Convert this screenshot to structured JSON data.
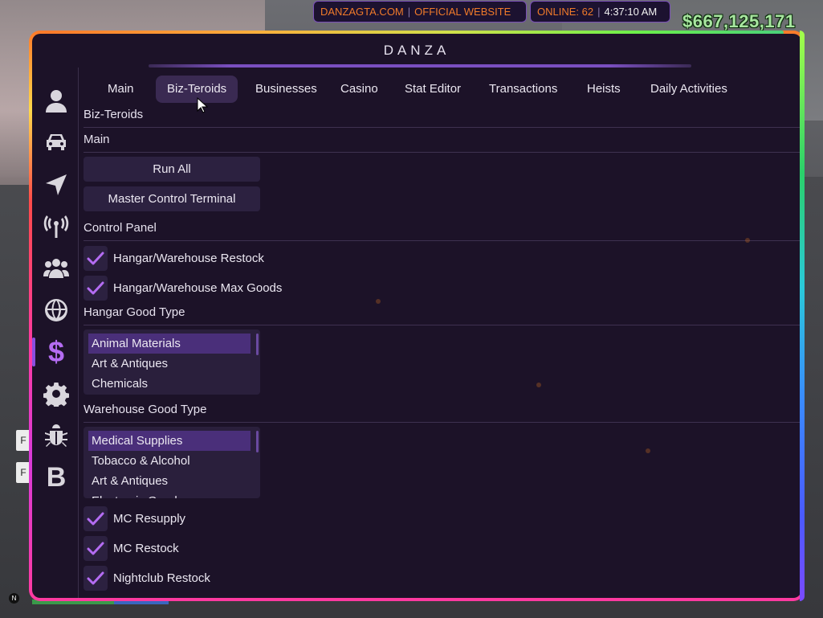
{
  "hud": {
    "site_label": "DANZAGTA.COM",
    "official_label": "OFFICIAL WEBSITE",
    "online_label": "ONLINE: 62",
    "time": "4:37:10 AM",
    "money": "$667,125,171",
    "side_hud_glyphs": [
      "F",
      "F"
    ],
    "north_label": "N"
  },
  "window": {
    "title": "DANZA"
  },
  "sidebar": {
    "items": [
      {
        "icon": "person-icon"
      },
      {
        "icon": "car-icon"
      },
      {
        "icon": "navigation-arrow-icon"
      },
      {
        "icon": "antenna-icon"
      },
      {
        "icon": "group-icon"
      },
      {
        "icon": "globe-icon"
      },
      {
        "icon": "dollar-icon",
        "glyph": "$",
        "active": true
      },
      {
        "icon": "gear-icon"
      },
      {
        "icon": "bug-icon"
      },
      {
        "icon": "b-letter-icon",
        "glyph": "B"
      }
    ]
  },
  "tabs": [
    {
      "label": "Main"
    },
    {
      "label": "Biz-Teroids",
      "active": true
    },
    {
      "label": "Businesses"
    },
    {
      "label": "Casino"
    },
    {
      "label": "Stat Editor"
    },
    {
      "label": "Transactions"
    },
    {
      "label": "Heists"
    },
    {
      "label": "Daily Activities"
    }
  ],
  "content": {
    "page_heading": "Biz-Teroids",
    "main_section": "Main",
    "buttons": {
      "run_all": "Run All",
      "master_control": "Master Control Terminal"
    },
    "control_panel_section": "Control Panel",
    "checks_top": [
      {
        "label": "Hangar/Warehouse Restock",
        "checked": true
      },
      {
        "label": "Hangar/Warehouse Max Goods",
        "checked": true
      }
    ],
    "hangar_section": "Hangar Good Type",
    "hangar_options": [
      "Animal Materials",
      "Art & Antiques",
      "Chemicals"
    ],
    "hangar_selected": "Animal Materials",
    "warehouse_section": "Warehouse Good Type",
    "warehouse_options": [
      "Medical Supplies",
      "Tobacco & Alcohol",
      "Art & Antiques",
      "Electronic Goods"
    ],
    "warehouse_selected": "Medical Supplies",
    "checks_bottom": [
      {
        "label": "MC Resupply",
        "checked": true
      },
      {
        "label": "MC Restock",
        "checked": true
      },
      {
        "label": "Nightclub Restock",
        "checked": true
      }
    ]
  },
  "colors": {
    "accent_purple": "#8a4fe0",
    "check_purple": "#b46cf2",
    "hud_orange": "#f07a2a",
    "money_green": "#a8e6a0",
    "panel_bg": "#1c1228"
  }
}
